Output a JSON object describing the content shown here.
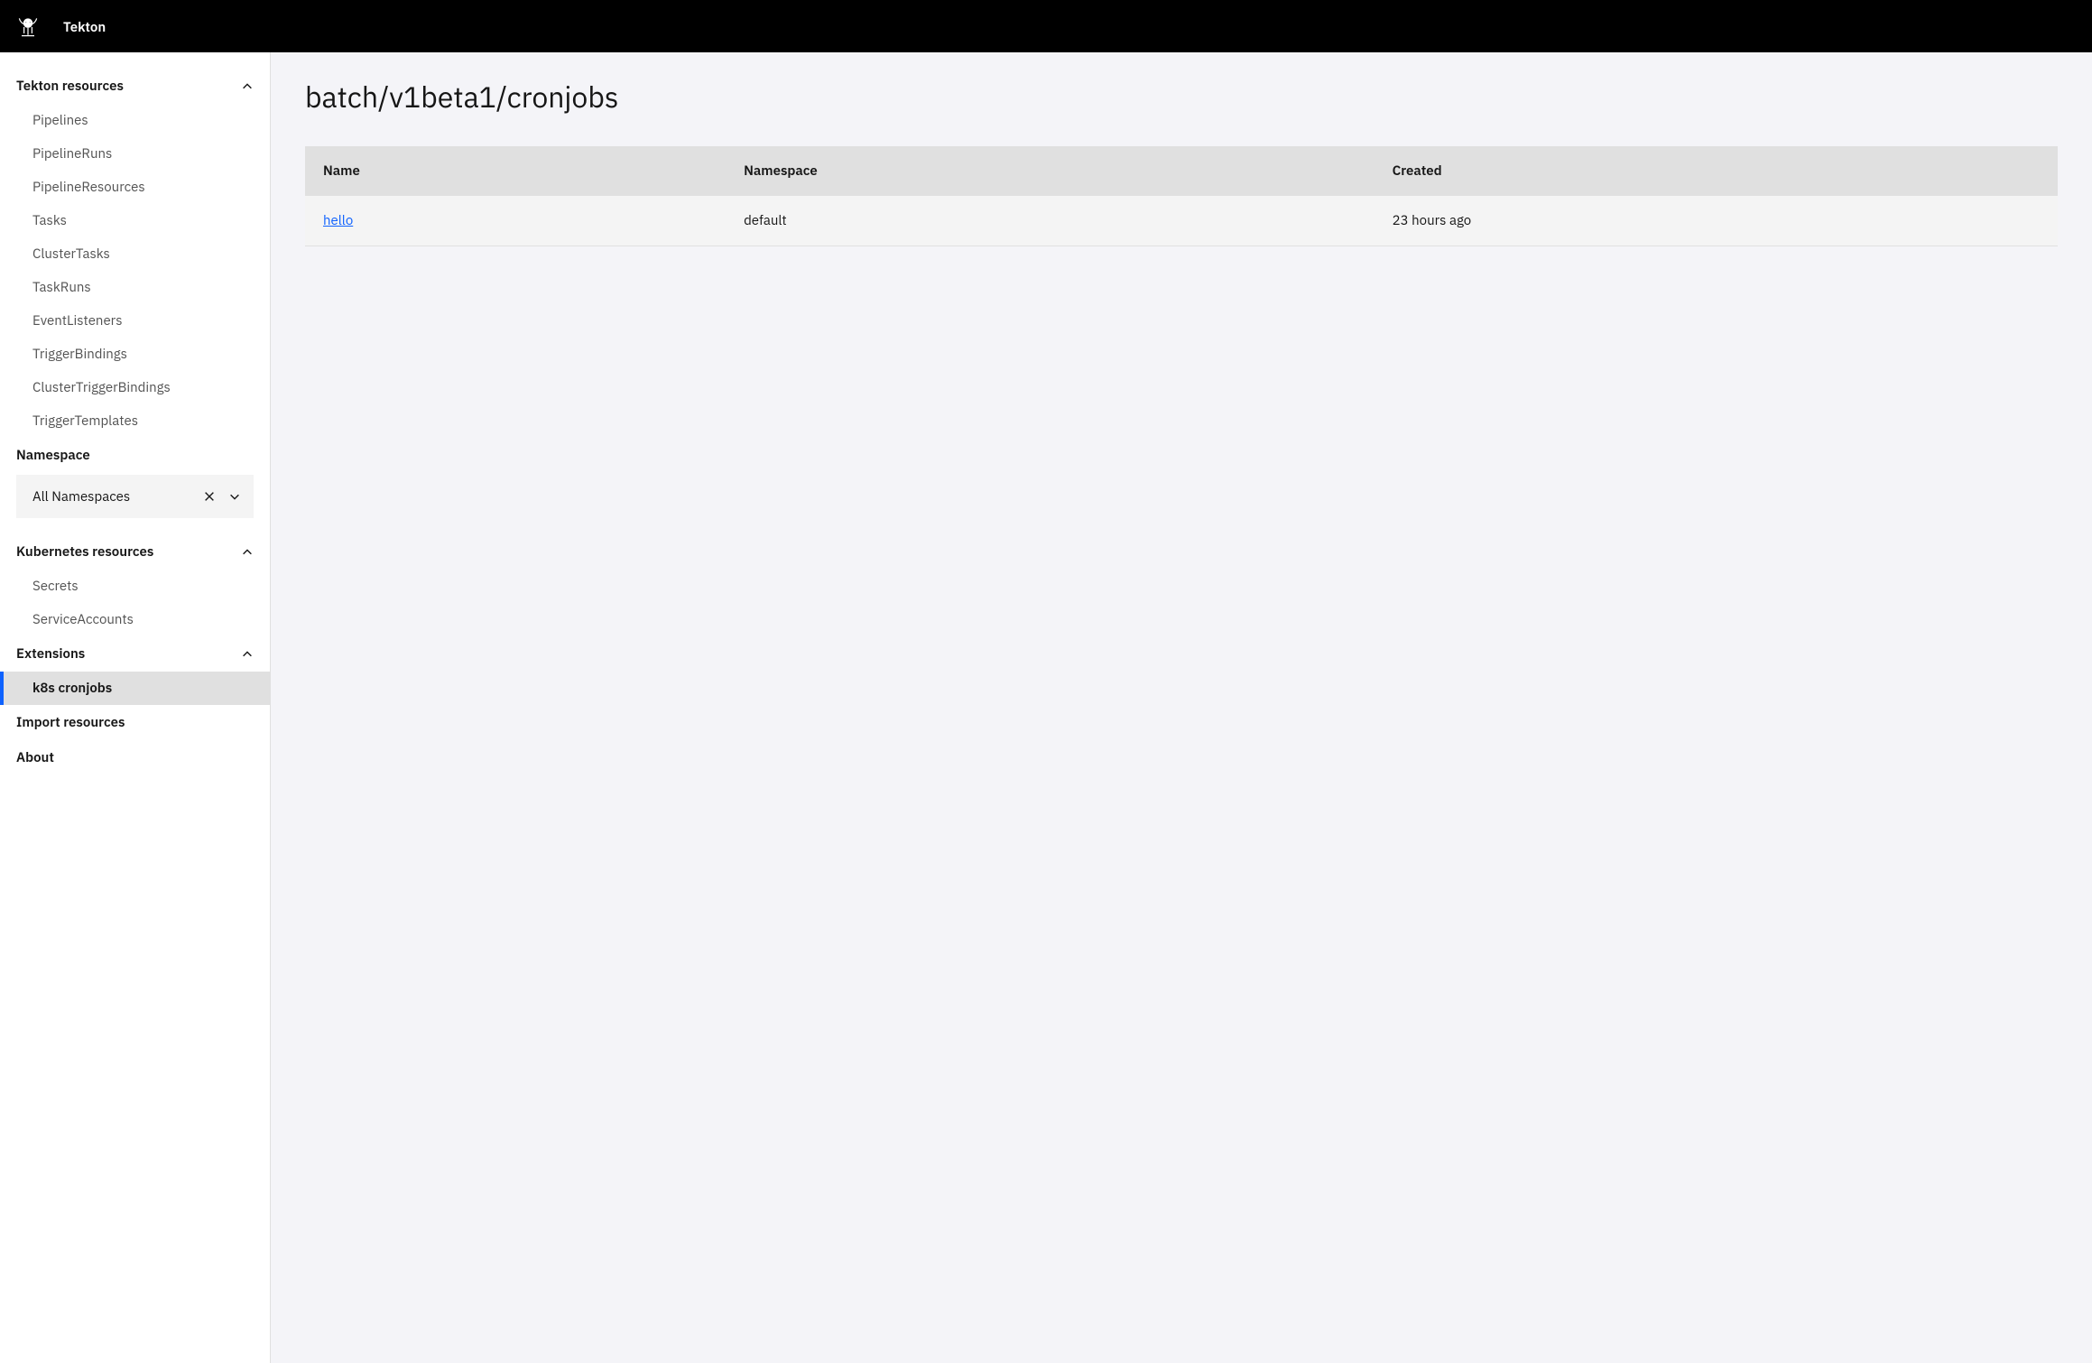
{
  "header": {
    "title": "Tekton"
  },
  "sidebar": {
    "sections": {
      "tekton": {
        "label": "Tekton resources",
        "items": [
          "Pipelines",
          "PipelineRuns",
          "PipelineResources",
          "Tasks",
          "ClusterTasks",
          "TaskRuns",
          "EventListeners",
          "TriggerBindings",
          "ClusterTriggerBindings",
          "TriggerTemplates"
        ]
      },
      "namespace": {
        "label": "Namespace",
        "selected": "All Namespaces"
      },
      "k8s": {
        "label": "Kubernetes resources",
        "items": [
          "Secrets",
          "ServiceAccounts"
        ]
      },
      "extensions": {
        "label": "Extensions",
        "items": [
          "k8s cronjobs"
        ]
      },
      "import": "Import resources",
      "about": "About"
    }
  },
  "main": {
    "title": "batch/v1beta1/cronjobs",
    "columns": {
      "name": "Name",
      "namespace": "Namespace",
      "created": "Created"
    },
    "rows": [
      {
        "name": "hello",
        "namespace": "default",
        "created": "23 hours ago"
      }
    ]
  }
}
